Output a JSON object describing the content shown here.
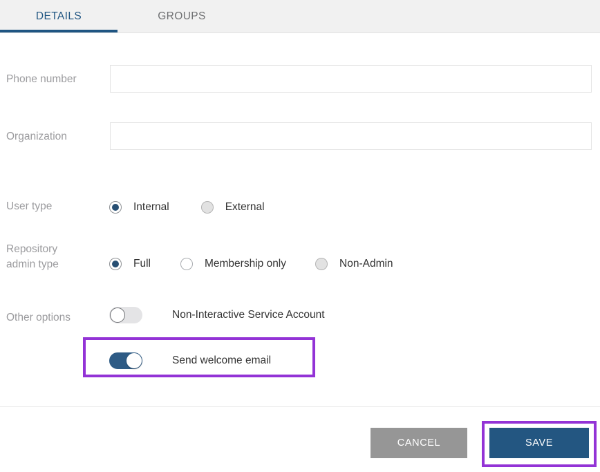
{
  "tabs": [
    {
      "label": "DETAILS",
      "active": true
    },
    {
      "label": "GROUPS",
      "active": false
    }
  ],
  "form": {
    "phone": {
      "label": "Phone number",
      "value": "",
      "placeholder": ""
    },
    "organization": {
      "label": "Organization",
      "value": "",
      "placeholder": ""
    },
    "user_type": {
      "label": "User type",
      "options": [
        {
          "label": "Internal",
          "selected": true,
          "disabled": false
        },
        {
          "label": "External",
          "selected": false,
          "disabled": true
        }
      ]
    },
    "repository_admin_type": {
      "label_line1": "Repository",
      "label_line2": "admin type",
      "options": [
        {
          "label": "Full",
          "selected": true,
          "disabled": false
        },
        {
          "label": "Membership only",
          "selected": false,
          "disabled": false
        },
        {
          "label": "Non-Admin",
          "selected": false,
          "disabled": true
        }
      ]
    },
    "other_options": {
      "label": "Other options",
      "toggles": [
        {
          "label": "Non-Interactive Service Account",
          "on": false
        },
        {
          "label": "Send welcome email",
          "on": true
        }
      ]
    }
  },
  "footer": {
    "cancel_label": "CANCEL",
    "save_label": "SAVE"
  },
  "colors": {
    "accent_navy": "#1f5582",
    "save_button": "#235681",
    "cancel_button": "#969696",
    "toggle_on": "#2e5b85",
    "radio_selected": "#274f73",
    "highlight_purple": "#9333d6",
    "label_gray": "#9b9b9e",
    "tabbar_bg": "#f1f1f1"
  }
}
